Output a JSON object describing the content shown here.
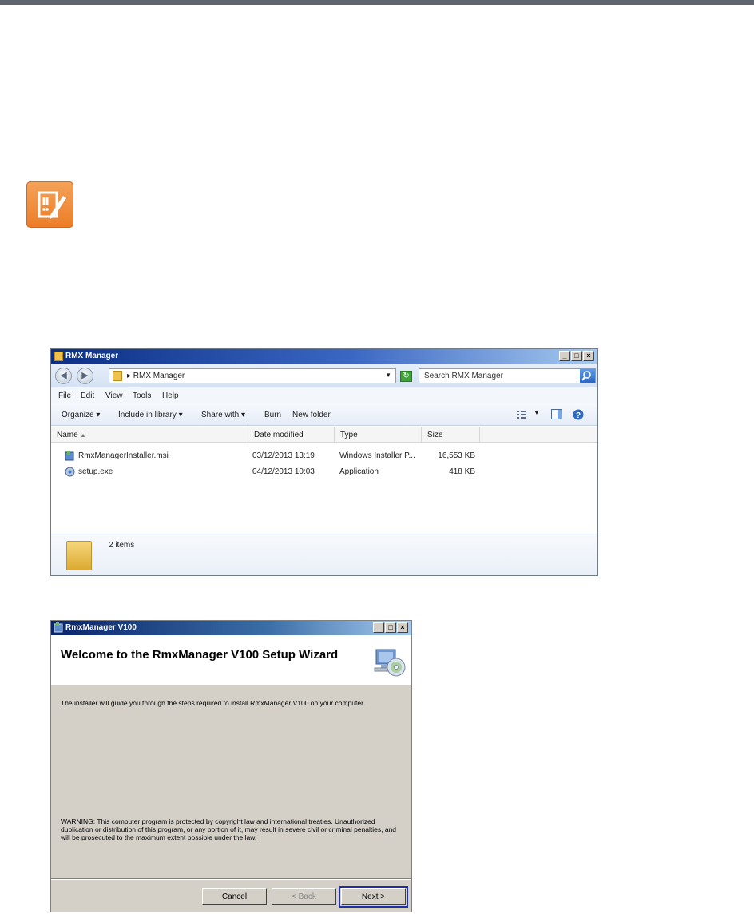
{
  "explorer": {
    "title": "RMX Manager",
    "address_path": "▸ RMX Manager",
    "search_placeholder": "Search RMX Manager",
    "menu": [
      "File",
      "Edit",
      "View",
      "Tools",
      "Help"
    ],
    "commands": [
      "Organize ▾",
      "Include in library ▾",
      "Share with ▾",
      "Burn",
      "New folder"
    ],
    "columns": [
      "Name",
      "Date modified",
      "Type",
      "Size"
    ],
    "files": [
      {
        "name": "RmxManagerInstaller.msi",
        "date": "03/12/2013 13:19",
        "type": "Windows Installer P...",
        "size": "16,553 KB"
      },
      {
        "name": "setup.exe",
        "date": "04/12/2013 10:03",
        "type": "Application",
        "size": "418 KB"
      }
    ],
    "status": "2 items"
  },
  "wizard": {
    "title": "RmxManager V100",
    "heading": "Welcome to the RmxManager V100 Setup Wizard",
    "body": "The installer will guide you through the steps required to install RmxManager V100 on your computer.",
    "warning": "WARNING: This computer program is protected by copyright law and international treaties. Unauthorized duplication or distribution of this program, or any portion of it, may result in severe civil or criminal penalties, and will be prosecuted to the maximum extent possible under the law.",
    "buttons": {
      "cancel": "Cancel",
      "back": "< Back",
      "next": "Next >"
    }
  },
  "colors": {
    "topbar": "#5f6670",
    "note_icon": "#ec7d27",
    "titlebar": "#0b2f83"
  }
}
